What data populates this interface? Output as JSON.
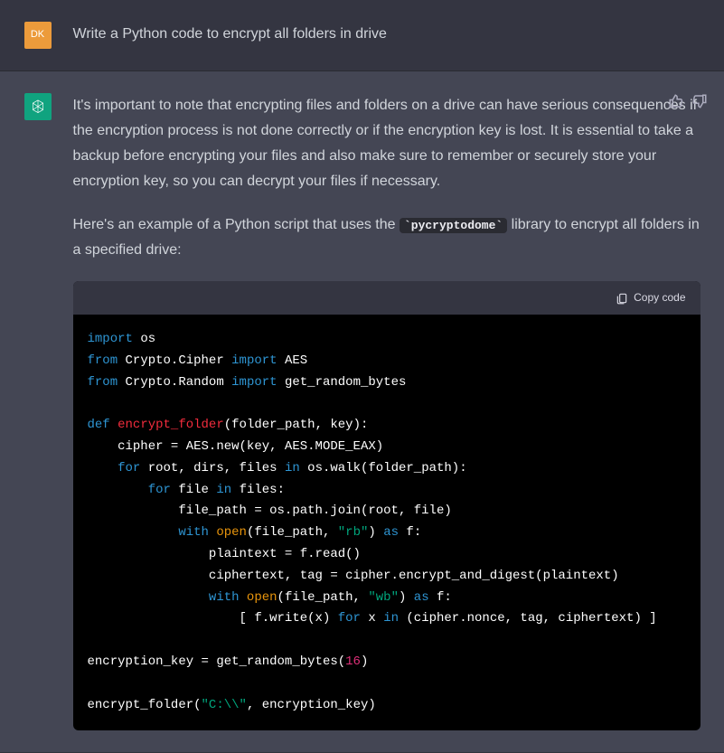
{
  "user": {
    "avatar_label": "DK",
    "message": "Write a Python code to encrypt all folders in drive"
  },
  "assistant": {
    "intro_paragraph": "It's important to note that encrypting files and folders on a drive can have serious consequences if the encryption process is not done correctly or if the encryption key is lost. It is essential to take a backup before encrypting your files and also make sure to remember or securely store your encryption key, so you can decrypt your files if necessary.",
    "example_prefix": "Here's an example of a Python script that uses the ",
    "library_name": "pycryptodome",
    "example_suffix": " library to encrypt all folders in a specified drive:"
  },
  "code_block": {
    "copy_label": "Copy code",
    "line1_kw1": "import",
    "line1_mod": " os",
    "line2_kw1": "from",
    "line2_mod": " Crypto.Cipher ",
    "line2_kw2": "import",
    "line2_sym": " AES",
    "line3_kw1": "from",
    "line3_mod": " Crypto.Random ",
    "line3_kw2": "import",
    "line3_sym": " get_random_bytes",
    "line5_kw": "def",
    "line5_name": " encrypt_folder",
    "line5_sig": "(folder_path, key):",
    "line6": "    cipher = AES.new(key, AES.MODE_EAX)",
    "line7_pre": "    ",
    "line7_kw1": "for",
    "line7_mid": " root, dirs, files ",
    "line7_kw2": "in",
    "line7_post": " os.walk(folder_path):",
    "line8_pre": "        ",
    "line8_kw1": "for",
    "line8_mid": " file ",
    "line8_kw2": "in",
    "line8_post": " files:",
    "line9": "            file_path = os.path.join(root, file)",
    "line10_pre": "            ",
    "line10_kw1": "with",
    "line10_open": " open",
    "line10_p1": "(file_path, ",
    "line10_str": "\"rb\"",
    "line10_p2": ") ",
    "line10_kw2": "as",
    "line10_post": " f:",
    "line11": "                plaintext = f.read()",
    "line12": "                ciphertext, tag = cipher.encrypt_and_digest(plaintext)",
    "line13_pre": "                ",
    "line13_kw1": "with",
    "line13_open": " open",
    "line13_p1": "(file_path, ",
    "line13_str": "\"wb\"",
    "line13_p2": ") ",
    "line13_kw2": "as",
    "line13_post": " f:",
    "line14_pre": "                    [ f.write(x) ",
    "line14_kw1": "for",
    "line14_mid": " x ",
    "line14_kw2": "in",
    "line14_post": " (cipher.nonce, tag, ciphertext) ]",
    "line16_pre": "encryption_key = get_random_bytes(",
    "line16_num": "16",
    "line16_post": ")",
    "line18_pre": "encrypt_folder(",
    "line18_str": "\"C:\\\\\"",
    "line18_post": ", encryption_key)"
  }
}
